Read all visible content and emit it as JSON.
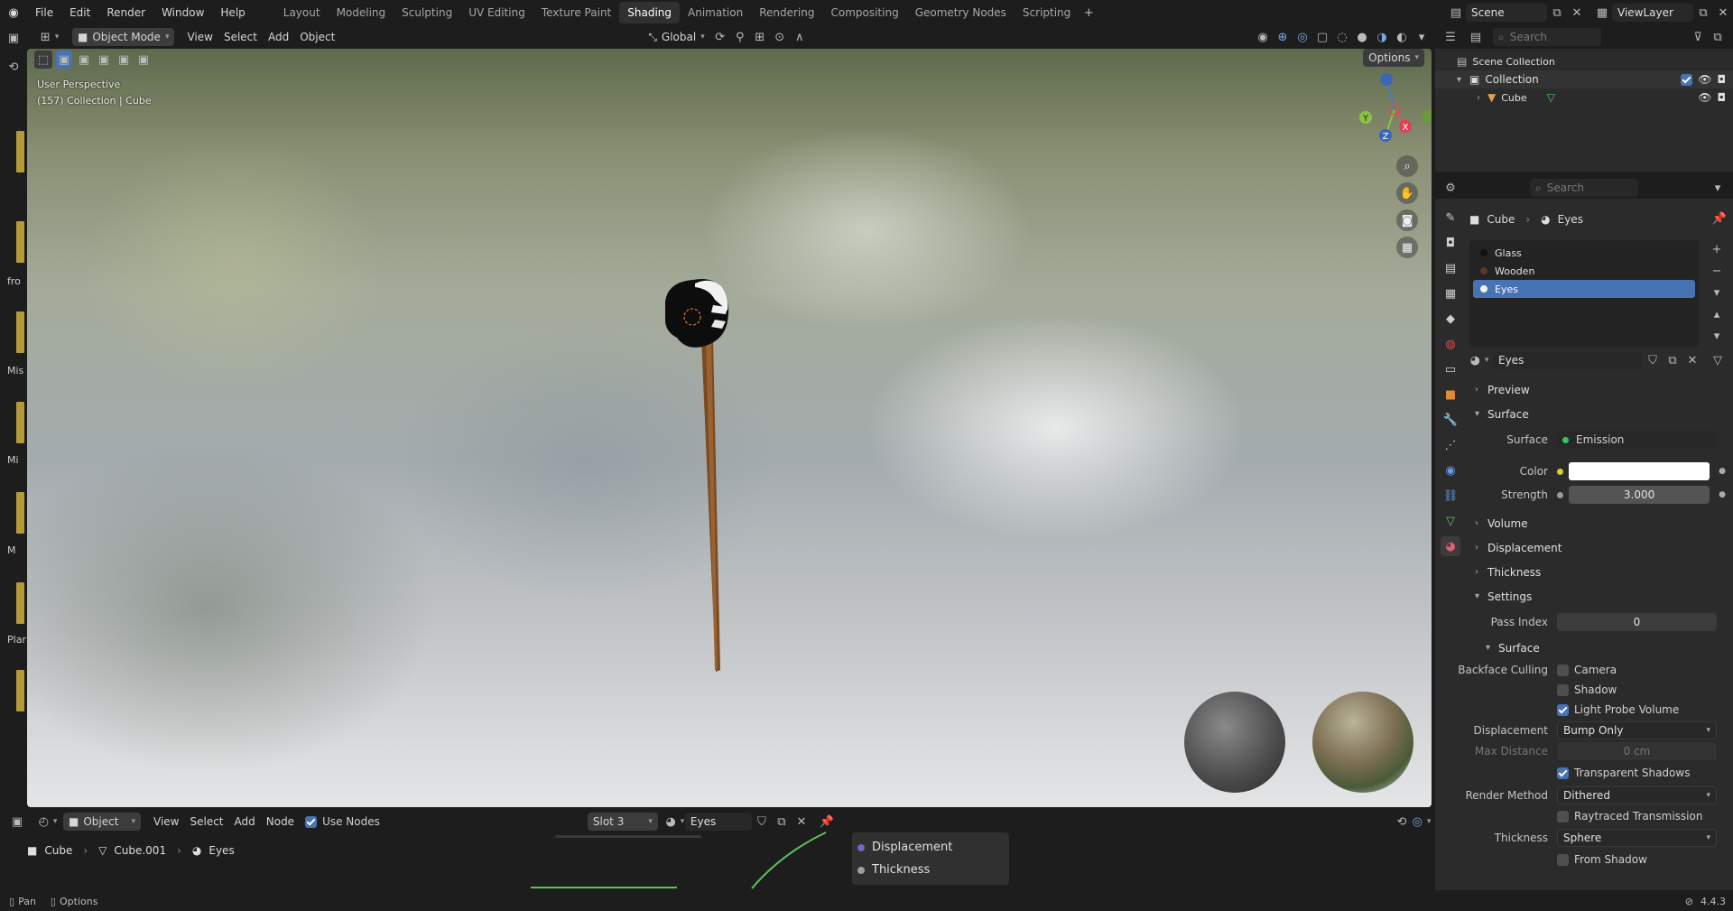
{
  "menu": [
    "File",
    "Edit",
    "Render",
    "Window",
    "Help"
  ],
  "workspaces": [
    "Layout",
    "Modeling",
    "Sculpting",
    "UV Editing",
    "Texture Paint",
    "Shading",
    "Animation",
    "Rendering",
    "Compositing",
    "Geometry Nodes",
    "Scripting"
  ],
  "active_workspace": "Shading",
  "scene": "Scene",
  "view_layer": "ViewLayer",
  "viewport_header": {
    "mode": "Object Mode",
    "view": "View",
    "select": "Select",
    "add": "Add",
    "object": "Object",
    "orientation": "Global",
    "options": "Options"
  },
  "viewport_overlay": {
    "perspective": "User Perspective",
    "info": "(157) Collection | Cube"
  },
  "left_side_labels": [
    "fro",
    "Mis",
    "Mi",
    "M",
    "Plar"
  ],
  "gizmo": {
    "x": "X",
    "y": "Y",
    "z": "Z"
  },
  "outliner": {
    "search_placeholder": "Search",
    "scene_collection": "Scene Collection",
    "collection": "Collection",
    "object": "Cube"
  },
  "properties": {
    "search_placeholder": "Search",
    "breadcrumb": {
      "object": "Cube",
      "material": "Eyes"
    },
    "material_slots": [
      "Glass",
      "Wooden",
      "Eyes"
    ],
    "selected_slot": "Eyes",
    "material_name": "Eyes",
    "panels": {
      "preview": "Preview",
      "surface": "Surface",
      "volume": "Volume",
      "displacement": "Displacement",
      "thickness": "Thickness",
      "settings": "Settings"
    },
    "surface": {
      "label": "Surface",
      "shader": "Emission",
      "color_label": "Color",
      "color_value": "#ffffff",
      "strength_label": "Strength",
      "strength": "3.000"
    },
    "settings": {
      "pass_index_label": "Pass Index",
      "pass_index": "0",
      "surface_sub": "Surface",
      "backface_label": "Backface Culling",
      "camera": "Camera",
      "shadow": "Shadow",
      "light_probe": "Light Probe Volume",
      "displacement_label": "Displacement",
      "displacement_value": "Bump Only",
      "max_distance_label": "Max Distance",
      "max_distance": "0 cm",
      "transparent_shadows": "Transparent Shadows",
      "render_method_label": "Render Method",
      "render_method": "Dithered",
      "raytraced": "Raytraced Transmission",
      "thickness_label": "Thickness",
      "thickness_value": "Sphere",
      "from_shadow": "From Shadow"
    }
  },
  "node_editor": {
    "type": "Object",
    "view": "View",
    "select": "Select",
    "add": "Add",
    "node": "Node",
    "use_nodes": "Use Nodes",
    "slot": "Slot 3",
    "material": "Eyes",
    "breadcrumb": [
      "Cube",
      "Cube.001",
      "Eyes"
    ],
    "sockets": [
      "Displacement",
      "Thickness"
    ]
  },
  "status_bar": {
    "pan": "Pan",
    "options": "Options",
    "version": "4.4.3"
  },
  "colors": {
    "accent": "#4772b3",
    "header": "#2b2b2b",
    "panel": "#303030",
    "background": "#1d1d1d"
  }
}
